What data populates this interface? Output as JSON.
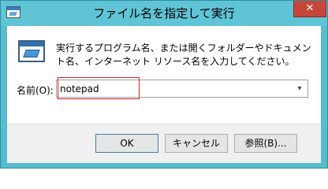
{
  "window": {
    "title": "ファイル名を指定して実行",
    "close_label": "✕"
  },
  "main": {
    "description": "実行するプログラム名、または開くフォルダーやドキュメント名、インターネット リソース名を入力してください。",
    "name_label": "名前(O):",
    "name_value": "notepad",
    "dropdown_icon": "chevron-down-icon"
  },
  "buttons": {
    "ok": "OK",
    "cancel": "キャンセル",
    "browse": "参照(B)..."
  },
  "colors": {
    "frame": "#58bccf",
    "close": "#c7463a",
    "highlight": "#d02020"
  }
}
